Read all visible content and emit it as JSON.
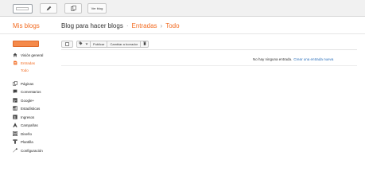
{
  "topbar": {
    "view_blog_label": "Ver blog",
    "icons": [
      "blogger-logo",
      "pencil-icon",
      "pages-icon"
    ]
  },
  "header": {
    "my_blogs": "Mis blogs",
    "blog_title": "Blog para hacer blogs",
    "separator": "·",
    "section": "Entradas",
    "arrow": "›",
    "filter": "Todo"
  },
  "sidebar": {
    "items": [
      {
        "label": "Visión general",
        "icon": "home-icon"
      },
      {
        "label": "Entradas",
        "icon": "posts-icon",
        "active": true
      },
      {
        "label": "Páginas",
        "icon": "pages-icon"
      },
      {
        "label": "Comentarios",
        "icon": "comments-icon"
      },
      {
        "label": "Google+",
        "icon": "google-plus-icon"
      },
      {
        "label": "Estadísticas",
        "icon": "stats-icon"
      },
      {
        "label": "Ingresos",
        "icon": "earnings-icon"
      },
      {
        "label": "Campañas",
        "icon": "campaigns-icon"
      },
      {
        "label": "Diseño",
        "icon": "layout-icon"
      },
      {
        "label": "Plantilla",
        "icon": "template-icon"
      },
      {
        "label": "Configuración",
        "icon": "settings-icon"
      }
    ],
    "sub_item": "Todo"
  },
  "toolbar": {
    "publish": "Publicar",
    "revert": "Cambiar a borrador"
  },
  "content": {
    "empty_text": "No hay ninguna entrada.",
    "create_link": "Crear una entrada nueva"
  },
  "colors": {
    "accent": "#f26b21",
    "link": "#2a6fbb"
  }
}
